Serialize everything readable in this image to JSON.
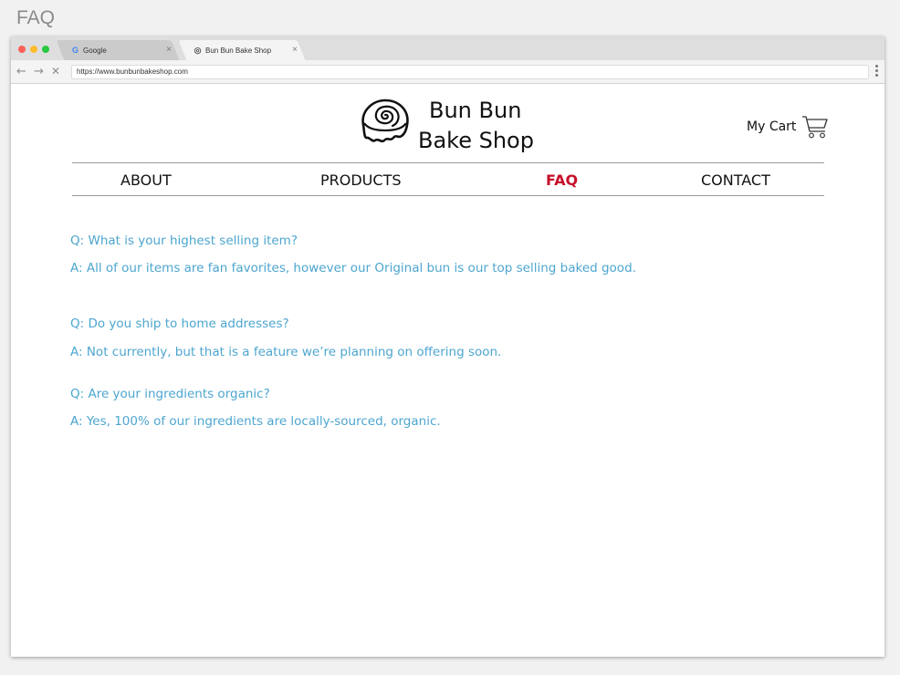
{
  "page_label": "FAQ",
  "browser": {
    "tabs": [
      {
        "favicon": "G",
        "title": "Google",
        "close": "×"
      },
      {
        "favicon": "◎",
        "title": "Bun Bun Bake Shop",
        "close": "×"
      }
    ],
    "url": "https://www.bunbunbakeshop.com",
    "nav_icons": {
      "back": "←",
      "forward": "→",
      "stop": "✕"
    }
  },
  "site": {
    "brand_line1": "Bun Bun",
    "brand_line2": "Bake Shop",
    "cart_label": "My Cart",
    "nav": [
      "ABOUT",
      "PRODUCTS",
      "FAQ",
      "CONTACT"
    ],
    "active_nav": "FAQ",
    "colors": {
      "accent": "#c7102a",
      "faq_text": "#4da6cf"
    }
  },
  "faq": [
    {
      "q": "Q: What is your highest selling item?",
      "a": "A: All of our items are fan favorites, however our Original bun is our top selling baked good."
    },
    {
      "q": "Q: Do you ship to home addresses?",
      "a": "A: Not currently, but that is a feature we’re planning on offering soon."
    },
    {
      "q": "Q: Are your ingredients organic?",
      "a": "A: Yes, 100% of our ingredients are locally-sourced, organic."
    }
  ]
}
